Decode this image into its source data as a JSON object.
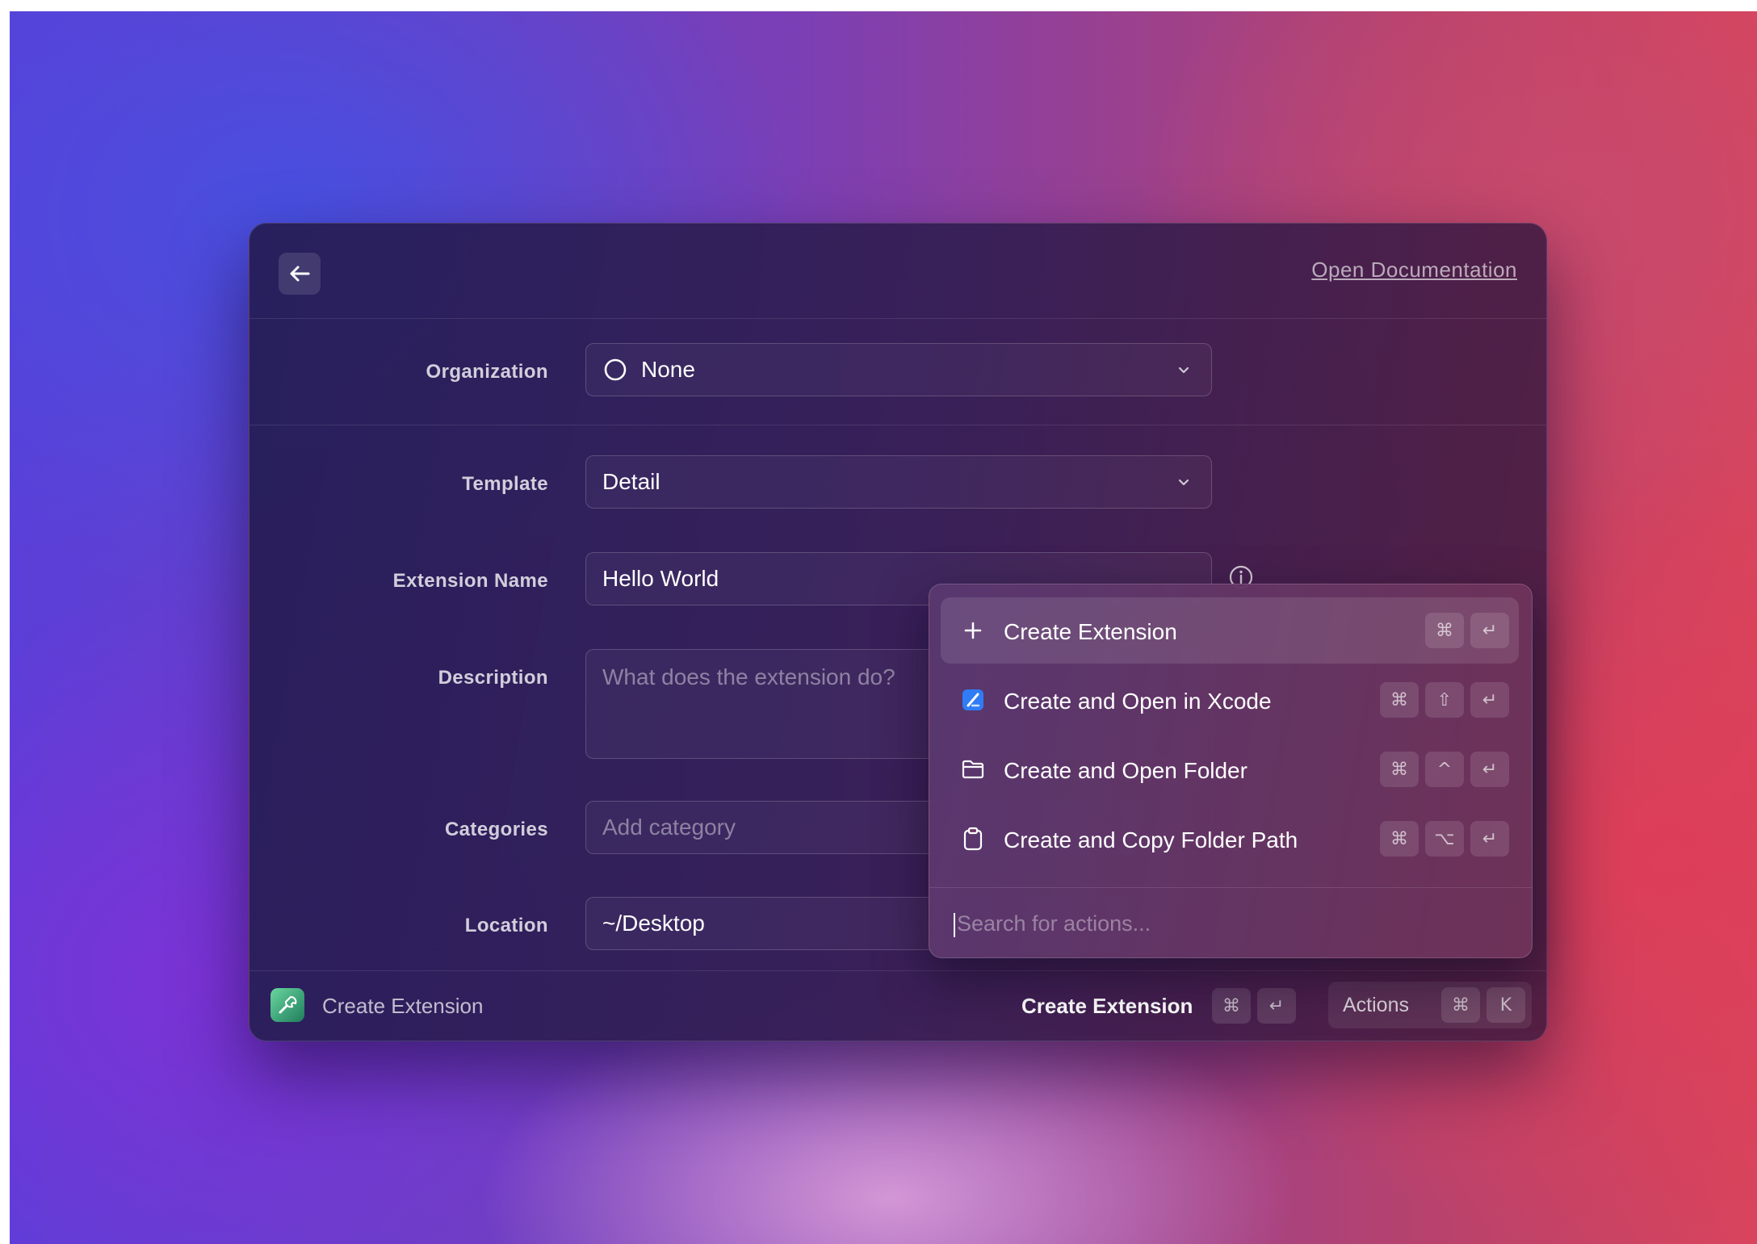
{
  "header": {
    "doc_link": "Open Documentation"
  },
  "form": {
    "organization": {
      "label": "Organization",
      "value": "None"
    },
    "template": {
      "label": "Template",
      "value": "Detail"
    },
    "extension_name": {
      "label": "Extension Name",
      "value": "Hello World"
    },
    "description": {
      "label": "Description",
      "placeholder": "What does the extension do?"
    },
    "categories": {
      "label": "Categories",
      "placeholder": "Add category"
    },
    "location": {
      "label": "Location",
      "value": "~/Desktop"
    }
  },
  "action_menu": {
    "items": [
      {
        "label": "Create Extension",
        "icon": "plus-icon",
        "shortcut": [
          "⌘",
          "↵"
        ],
        "selected": true
      },
      {
        "label": "Create and Open in Xcode",
        "icon": "xcode-icon",
        "shortcut": [
          "⌘",
          "⇧",
          "↵"
        ]
      },
      {
        "label": "Create and Open Folder",
        "icon": "folder-icon",
        "shortcut": [
          "⌘",
          "^",
          "↵"
        ]
      },
      {
        "label": "Create and Copy Folder Path",
        "icon": "clipboard-icon",
        "shortcut": [
          "⌘",
          "⌥",
          "↵"
        ]
      }
    ],
    "search_placeholder": "Search for actions..."
  },
  "footer": {
    "title": "Create Extension",
    "primary_action": "Create Extension",
    "primary_shortcut": [
      "⌘",
      "↵"
    ],
    "actions_label": "Actions",
    "actions_shortcut": [
      "⌘",
      "K"
    ]
  },
  "colors": {
    "window_bg": "#2a1f55",
    "menu_bg": "#5e3a70",
    "accent_green": "#3fa678",
    "xcode_blue": "#2f7cf6"
  }
}
